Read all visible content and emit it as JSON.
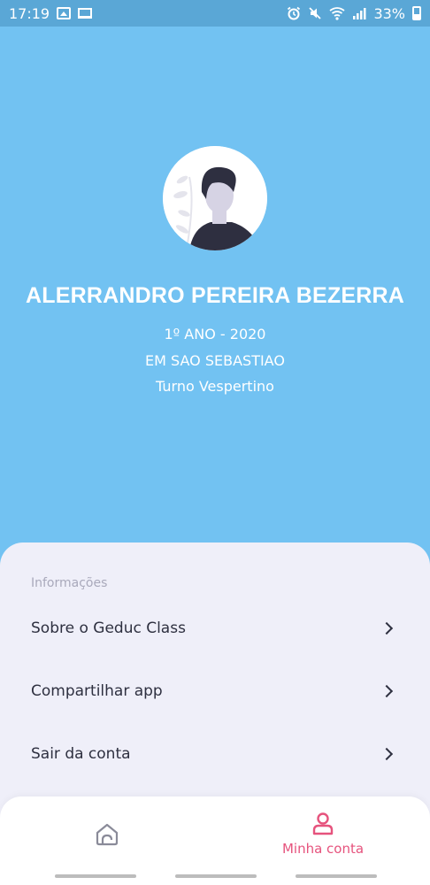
{
  "status_bar": {
    "time": "17:19",
    "battery": "33%",
    "icons": [
      "image-icon",
      "laptop-icon",
      "alarm-icon",
      "mute-icon",
      "wifi-icon",
      "signal-icon",
      "battery-icon"
    ]
  },
  "profile": {
    "name": "ALERRANDRO PEREIRA BEZERRA",
    "grade": "1º ANO  - 2020",
    "school": "EM SAO SEBASTIAO",
    "shift": "Turno Vespertino"
  },
  "info": {
    "section_title": "Informações",
    "items": [
      {
        "label": "Sobre o Geduc Class"
      },
      {
        "label": "Compartilhar app"
      },
      {
        "label": "Sair da conta"
      }
    ]
  },
  "nav": {
    "home_icon": "home-icon",
    "account_icon": "user-icon",
    "account_label": "Minha conta"
  },
  "colors": {
    "background": "#72c2f2",
    "status_bar": "#5aa7d6",
    "sheet": "#efeff9",
    "accent": "#e6537d",
    "text": "#2e3040",
    "muted": "#a9a9bb"
  }
}
